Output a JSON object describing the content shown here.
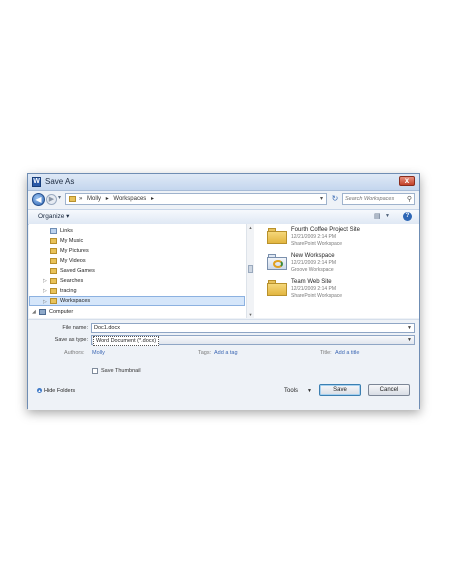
{
  "window": {
    "title": "Save As",
    "close_glyph": "x"
  },
  "address_bar": {
    "crumbs": [
      "»",
      "Molly",
      "▸",
      "Workspaces",
      "▸"
    ],
    "search_placeholder": "Search Workspaces"
  },
  "toolbar": {
    "organize_label": "Organize ▾",
    "view_icon": "views-icon",
    "help_icon": "help-icon"
  },
  "nav_pane": {
    "items": [
      {
        "label": "Links",
        "icon": "links-icon",
        "expander": ""
      },
      {
        "label": "My Music",
        "icon": "folder-icon",
        "expander": ""
      },
      {
        "label": "My Pictures",
        "icon": "folder-icon",
        "expander": ""
      },
      {
        "label": "My Videos",
        "icon": "folder-icon",
        "expander": ""
      },
      {
        "label": "Saved Games",
        "icon": "folder-icon",
        "expander": ""
      },
      {
        "label": "Searches",
        "icon": "folder-icon",
        "expander": "▷"
      },
      {
        "label": "tracing",
        "icon": "folder-icon",
        "expander": "▷"
      },
      {
        "label": "Workspaces",
        "icon": "folder-icon",
        "expander": "▷",
        "selected": true
      },
      {
        "label": "Computer",
        "icon": "computer-icon",
        "expander": "◢"
      }
    ]
  },
  "files": [
    {
      "name": "Fourth Coffee Project Site",
      "date": "12/21/2009 2:14 PM",
      "type": "SharePoint Workspace",
      "icon": "sharepoint-workspace-icon"
    },
    {
      "name": "New Workspace",
      "date": "12/21/2009 2:14 PM",
      "type": "Groove Workspace",
      "icon": "groove-workspace-icon"
    },
    {
      "name": "Team Web Site",
      "date": "12/21/2009 2:14 PM",
      "type": "SharePoint Workspace",
      "icon": "sharepoint-workspace-icon"
    }
  ],
  "form": {
    "filename_label": "File name:",
    "filename_value": "Doc1.docx",
    "savetype_label": "Save as type:",
    "savetype_value": "Word Document (*.docx)",
    "authors_label": "Authors:",
    "authors_value": "Molly",
    "tags_label": "Tags:",
    "tags_value": "Add a tag",
    "title_label": "Title:",
    "title_value": "Add a title",
    "thumbnail_label": "Save Thumbnail",
    "thumbnail_checked": false
  },
  "footer": {
    "hide_folders_label": "Hide Folders",
    "tools_label": "Tools",
    "save_label": "Save",
    "cancel_label": "Cancel"
  }
}
